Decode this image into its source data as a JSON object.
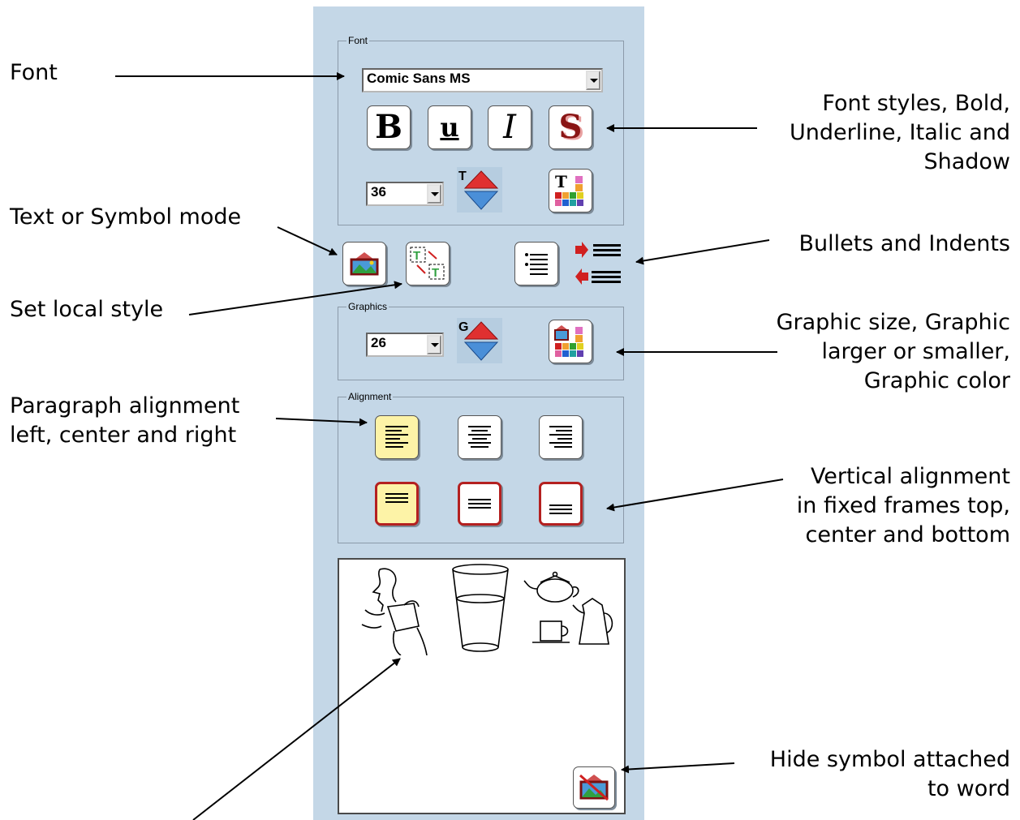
{
  "annotations": {
    "font": "Font",
    "font_styles": [
      "Font styles, Bold,",
      "Underline, Italic and",
      "Shadow"
    ],
    "text_symbol_mode": "Text or Symbol mode",
    "set_local_style": "Set local style",
    "bullets_indents": "Bullets and Indents",
    "graphic_size": [
      "Graphic size, Graphic",
      "larger or smaller,",
      "Graphic color"
    ],
    "paragraph_alignment": [
      "Paragraph alignment",
      "left, center and right"
    ],
    "vertical_alignment": [
      "Vertical alignment",
      "in fixed frames top,",
      "center and bottom"
    ],
    "hide_symbol": [
      "Hide symbol attached",
      "to word"
    ]
  },
  "panel": {
    "font_group": {
      "title": "Font",
      "font_name": "Comic Sans MS",
      "font_size": "36",
      "style_buttons": {
        "bold": "B",
        "underline": "u",
        "italic": "I",
        "shadow": "S"
      },
      "size_arrow_letter": "T",
      "color_button_letter": "T"
    },
    "graphics_group": {
      "title": "Graphics",
      "graphic_size": "26",
      "size_arrow_letter": "G"
    },
    "alignment_group": {
      "title": "Alignment",
      "selected_paragraph": "left",
      "selected_vertical": "top"
    },
    "symbols": [
      "drink-symbol",
      "glass-symbol",
      "tea-coffee-symbol"
    ]
  },
  "colors": {
    "panel_bg": "#c4d7e7",
    "selected_bg": "#fdf3a7",
    "frame_red": "#b42020",
    "up_red": "#e03030",
    "down_blue": "#4a8fd8"
  }
}
